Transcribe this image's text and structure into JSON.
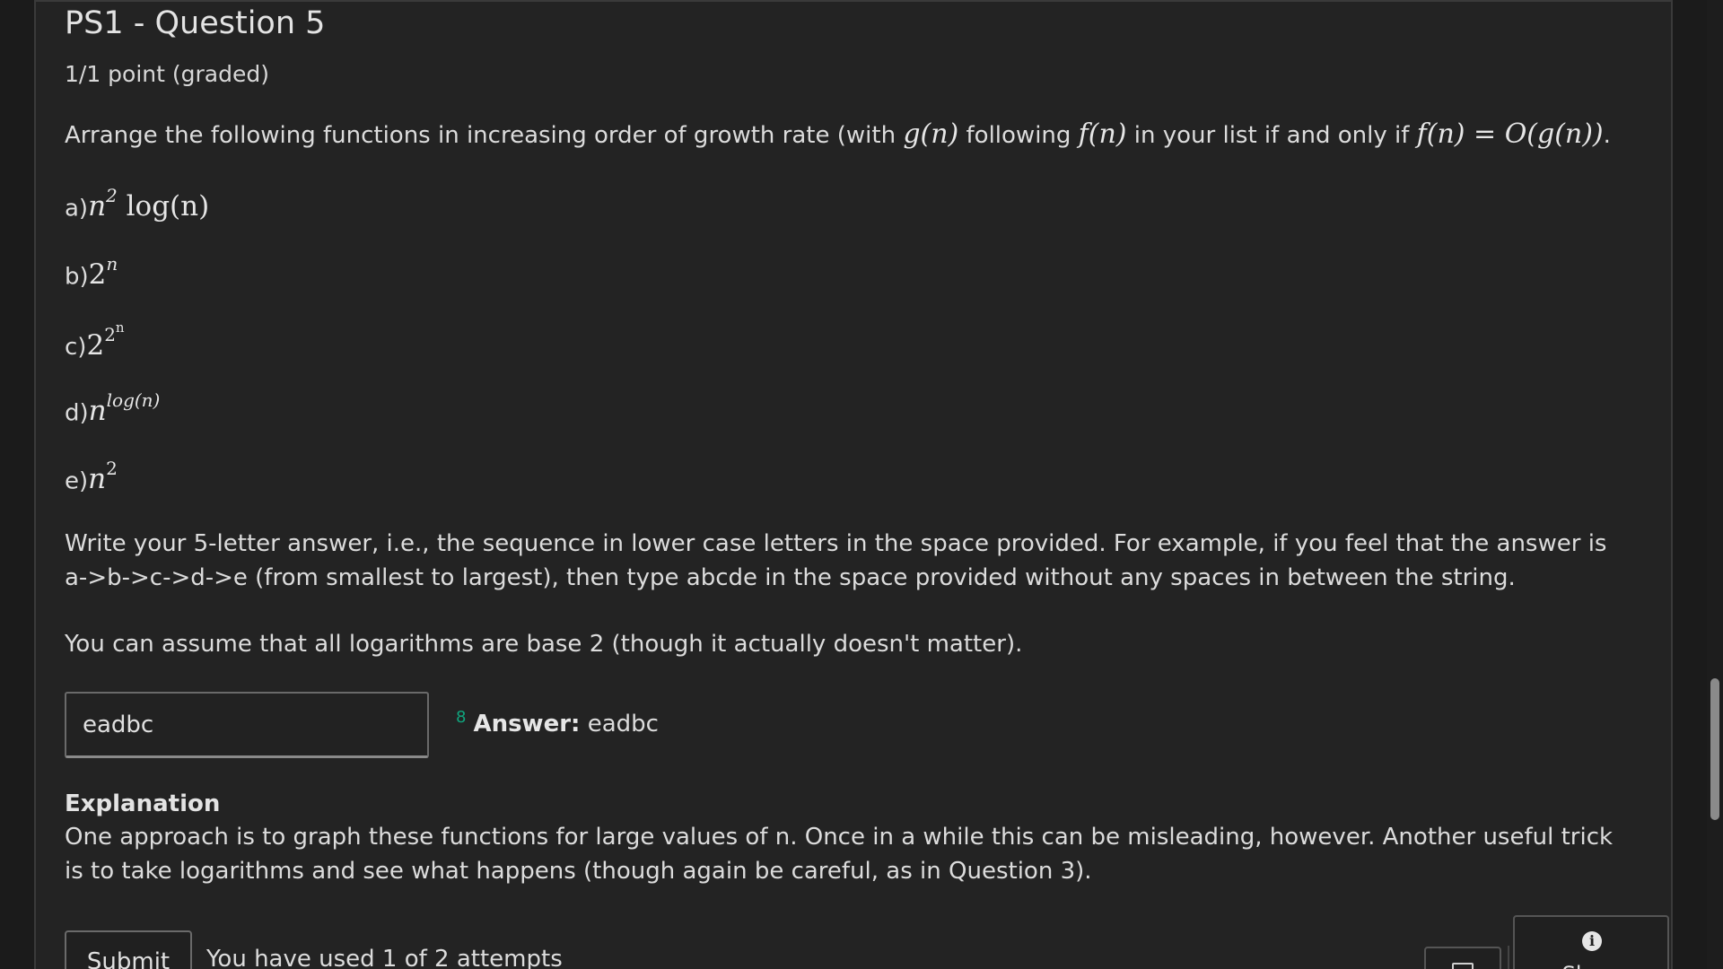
{
  "problem": {
    "title": "PS1 - Question 5",
    "points": "1/1 point (graded)",
    "prompt_pre": "Arrange the following functions in increasing order of growth rate (with ",
    "prompt_g": "g(n)",
    "prompt_mid1": " following ",
    "prompt_f": "f(n)",
    "prompt_mid2": " in your list if and only if ",
    "prompt_rel": "f(n) = O(g(n))",
    "prompt_end": ".",
    "options": [
      {
        "label": "a)",
        "base": "n",
        "exp": "2",
        "tail": " log(n)"
      },
      {
        "label": "b)",
        "base": "2",
        "exp": "n"
      },
      {
        "label": "c)",
        "base": "2",
        "exp": "2",
        "exp2": "n"
      },
      {
        "label": "d)",
        "base": "n",
        "exp": "log(n)"
      },
      {
        "label": "e)",
        "base": "n",
        "exp": "2"
      }
    ],
    "instructions": "Write your 5-letter answer, i.e., the sequence in lower case letters in the space provided. For example, if you feel that the answer is a->b->c->d->e (from smallest to largest), then type abcde in the space provided without any spaces in between the string.",
    "assumption": "You can assume that all logarithms are base 2 (though it actually doesn't matter)."
  },
  "answer": {
    "input_value": "eadbc",
    "marker": "8",
    "label": "Answer:",
    "value": " eadbc"
  },
  "explanation": {
    "title": "Explanation",
    "text": "One approach is to graph these functions for large values of n. Once in a while this can be misleading, however. Another useful trick is to take logarithms and see what happens (though again be careful, as in Question 3)."
  },
  "actions": {
    "submit_label": "Submit",
    "attempts_text": "You have used 1 of 2 attempts",
    "show_label": "Show",
    "info_glyph": "i"
  },
  "icons": [
    "save-icon",
    "info-icon"
  ],
  "colors": {
    "background": "#232323",
    "text": "#dcdcdc",
    "accent": "#10a57e"
  }
}
